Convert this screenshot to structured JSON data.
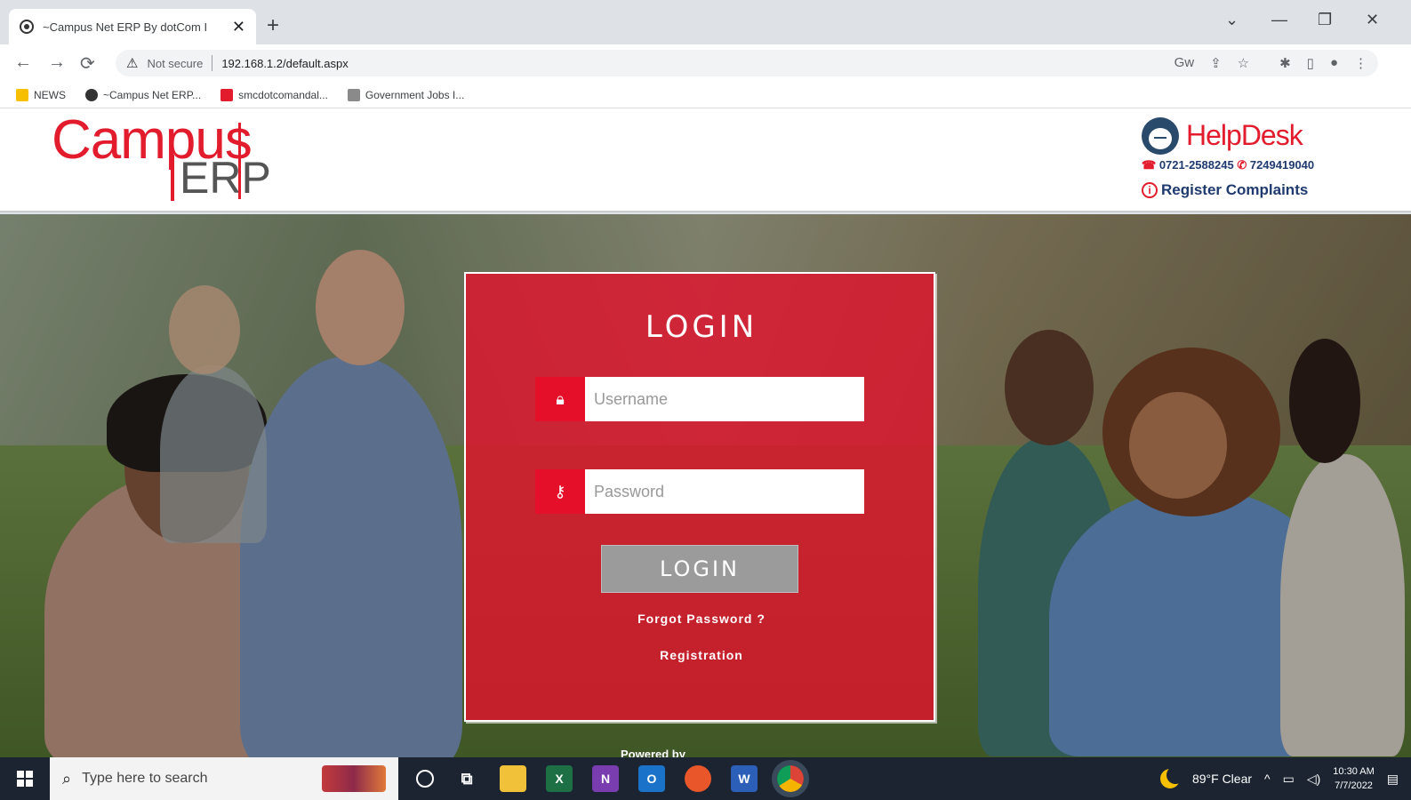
{
  "browser": {
    "tab_title": "~Campus Net ERP By dotCom I",
    "tab_close": "✕",
    "new_tab": "+",
    "controls": {
      "chevron": "⌄",
      "minimize": "—",
      "restore": "❐",
      "close": "✕"
    },
    "nav": {
      "back": "←",
      "forward": "→",
      "reload": "⟳"
    },
    "security_icon": "⚠",
    "not_secure": "Not secure",
    "url": "192.168.1.2/default.aspx",
    "omnibox_icons": [
      "Gw",
      "⇪",
      "☆"
    ],
    "toolbar_icons": [
      "puzzle-icon",
      "sidepanel-icon",
      "profile-icon",
      "menu-icon"
    ],
    "bookmarks": [
      {
        "label": "NEWS",
        "color": "#f6c000"
      },
      {
        "label": "~Campus Net ERP...",
        "color": "#333333"
      },
      {
        "label": "smcdotcomandal...",
        "color": "#e21b2d"
      },
      {
        "label": "Government Jobs I...",
        "color": "#8a8a8a"
      }
    ]
  },
  "header": {
    "logo_campus": "Campus",
    "logo_erp": "ERP",
    "helpdesk_title": "HelpDesk",
    "phone1": "0721-2588245",
    "phone2": "7249419040",
    "register_complaints": "Register Complaints"
  },
  "login": {
    "title": "LOGIN",
    "username_placeholder": "Username",
    "password_placeholder": "Password",
    "button_label": "LOGIN",
    "forgot_password": "Forgot Password ?",
    "registration": "Registration",
    "powered_by": "Powered by"
  },
  "taskbar": {
    "search_placeholder": "Type here to search",
    "weather": "89°F Clear",
    "time": "10:30 AM",
    "date": "7/7/2022",
    "apps": [
      {
        "name": "cortana-icon",
        "color": "transparent",
        "glyph": "○"
      },
      {
        "name": "task-view-icon",
        "color": "transparent",
        "glyph": "⧉"
      },
      {
        "name": "file-explorer-icon",
        "color": "#f2c13a",
        "glyph": ""
      },
      {
        "name": "excel-icon",
        "color": "#1d7044",
        "glyph": "X"
      },
      {
        "name": "onenote-icon",
        "color": "#7a3db0",
        "glyph": "N"
      },
      {
        "name": "outlook-icon",
        "color": "#1a73c8",
        "glyph": "O"
      },
      {
        "name": "firefox-icon",
        "color": "#e8562a",
        "glyph": ""
      },
      {
        "name": "word-icon",
        "color": "#2b5fb8",
        "glyph": "W"
      },
      {
        "name": "chrome-icon",
        "color": "#3c8f3c",
        "glyph": ""
      }
    ]
  },
  "colors": {
    "brand_red": "#e21b2d",
    "helpdesk_blue": "#1f3a6e",
    "login_button_gray": "#9b9b9b"
  }
}
